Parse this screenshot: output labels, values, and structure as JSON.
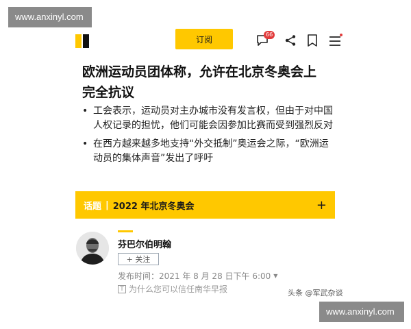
{
  "watermark": {
    "top": "www.anxinyl.com",
    "bottom": "www.anxinyl.com"
  },
  "header": {
    "subscribe_label": "订阅",
    "comment_count": "66",
    "icons": [
      "logo",
      "comment-icon",
      "share-icon",
      "bookmark-icon",
      "menu-icon"
    ]
  },
  "article": {
    "headline": "欧洲运动员团体称，允许在北京冬奥会上完全抗议",
    "bullets": [
      "工会表示，运动员对主办城市没有发言权，但由于对中国人权记录的担忧，他们可能会因参加比赛而受到强烈反对",
      "在西方越来越多地支持“外交抵制”奥运会之际，“欧洲运动员的集体声音”发出了呼吁"
    ]
  },
  "topic": {
    "tag": "话题",
    "separator": "|",
    "title": "2022 年北京冬奥会",
    "plus": "+"
  },
  "author": {
    "name": "芬巴尔伯明翰",
    "follow_label": "+ 关注",
    "publish_time": "发布时间：2021 年 8 月 28 日下午 6:00",
    "trust_link": "为什么您可以信任南华早报"
  },
  "source_tag": "头条 @军武杂谈",
  "colors": {
    "accent": "#ffc800",
    "badge": "#e23b3b"
  }
}
